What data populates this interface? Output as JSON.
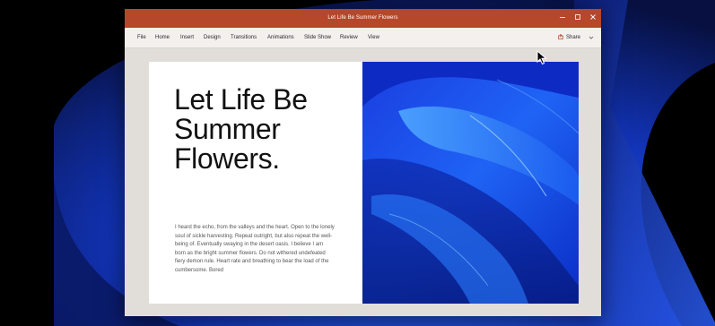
{
  "window": {
    "title": "Let Life Be Summer Flowers",
    "controls": [
      "minimize-icon",
      "maximize-icon",
      "close-icon"
    ]
  },
  "ribbon": {
    "tabs": [
      "File",
      "Home",
      "Insert",
      "Design",
      "Transitions",
      "Animations",
      "Slide Show",
      "Review",
      "View"
    ],
    "share_label": "Share"
  },
  "slide": {
    "title": "Let Life Be Summer Flowers.",
    "body": "I heard the echo, from the valleys and the heart. Open to the lonely soul of sickle harvesting. Repeat outright, but also repeat the well-being of. Eventually swaying in the desert oasis. I believe I am born as the bright summer flowers. Do not withered undefeated fiery demon rule. Heart rate and breathing to bear the load of the cumbersome. Bored"
  },
  "colors": {
    "titlebar": "#b7472a",
    "ribbon": "#f3f0ed",
    "canvas": "#e1ddd9",
    "desktop": "#000000",
    "accent_blue": "#1f5ff0"
  }
}
